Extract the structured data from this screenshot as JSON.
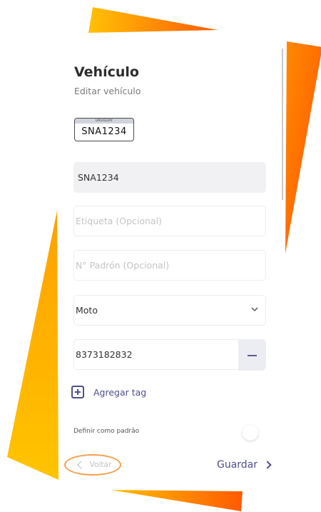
{
  "header": {
    "title": "Vehículo",
    "subtitle": "Editar vehículo"
  },
  "plate": {
    "country": "URUGUAY",
    "number": "SNA1234"
  },
  "form": {
    "plate_value": "SNA1234",
    "label_placeholder": "Etiqueta (Opcional)",
    "padron_placeholder": "N° Padrón (Opcional)",
    "vehicle_type": "Moto",
    "tag_value": "8373182832",
    "add_tag_label": "Agregar tag",
    "default_label": "Definir como padrão"
  },
  "footer": {
    "back_label": "Voltar",
    "save_label": "Guardar"
  },
  "colors": {
    "accent": "#4e4e8c",
    "highlight": "#f5a04a",
    "gradient_start": "#ffc107",
    "gradient_end": "#ff5a00"
  },
  "icons": {
    "add": "plus-square-icon",
    "remove": "minus-icon",
    "dropdown": "chevron-down-icon",
    "back": "chevron-left-icon",
    "next": "chevron-right-icon"
  }
}
